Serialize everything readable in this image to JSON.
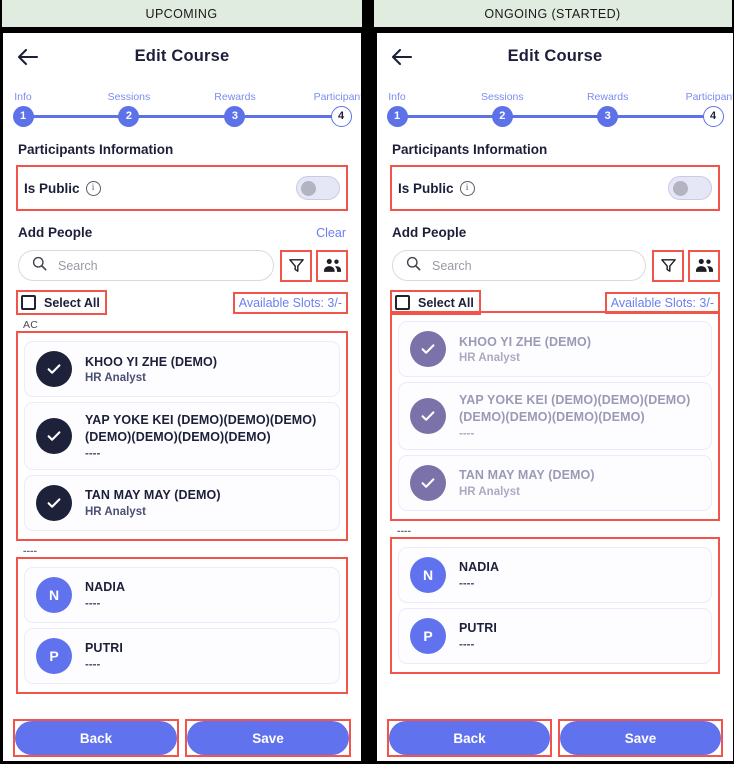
{
  "panels": [
    {
      "id": "upcoming",
      "status_banner": "UPCOMING",
      "appbar": {
        "title": "Edit Course",
        "back_icon": "arrow-left-icon"
      },
      "stepper": {
        "steps": [
          {
            "label": "Info",
            "number": "1",
            "state": "done"
          },
          {
            "label": "Sessions",
            "number": "2",
            "state": "done"
          },
          {
            "label": "Rewards",
            "number": "3",
            "state": "done"
          },
          {
            "label": "Participants",
            "number": "4",
            "state": "current"
          }
        ]
      },
      "participants_information_title": "Participants Information",
      "is_public": {
        "label": "Is Public",
        "info_icon": "info-icon",
        "toggle_state": "off"
      },
      "add_people": {
        "title": "Add People",
        "clear_label": "Clear",
        "show_clear": true
      },
      "search": {
        "placeholder": "Search",
        "value": "",
        "search_icon": "search-icon",
        "filter_icon": "filter-icon",
        "group-icon": "people-group-icon"
      },
      "select_all": {
        "label": "Select All",
        "checked": false
      },
      "available_slots": "Available Slots: 3/-",
      "groups": [
        {
          "label": "AC",
          "dim": false,
          "people": [
            {
              "name": "KHOO YI ZHE (DEMO)",
              "sub": "HR Analyst",
              "avatar_type": "check",
              "avatar_text": ""
            },
            {
              "name": "YAP YOKE KEI (DEMO)(DEMO)(DEMO)(DEMO)(DEMO)(DEMO)(DEMO)",
              "sub": "----",
              "avatar_type": "check",
              "avatar_text": ""
            },
            {
              "name": "TAN MAY MAY (DEMO)",
              "sub": "HR Analyst",
              "avatar_type": "check",
              "avatar_text": ""
            }
          ]
        },
        {
          "label": "----",
          "dim": false,
          "people": [
            {
              "name": "NADIA",
              "sub": "----",
              "avatar_type": "initial",
              "avatar_text": "N"
            },
            {
              "name": "PUTRI",
              "sub": "----",
              "avatar_type": "initial",
              "avatar_text": "P"
            }
          ]
        }
      ],
      "buttons": {
        "back": "Back",
        "save": "Save"
      }
    },
    {
      "id": "ongoing",
      "status_banner": "ONGOING (STARTED)",
      "appbar": {
        "title": "Edit Course",
        "back_icon": "arrow-left-icon"
      },
      "stepper": {
        "steps": [
          {
            "label": "Info",
            "number": "1",
            "state": "done"
          },
          {
            "label": "Sessions",
            "number": "2",
            "state": "done"
          },
          {
            "label": "Rewards",
            "number": "3",
            "state": "done"
          },
          {
            "label": "Participants",
            "number": "4",
            "state": "current"
          }
        ]
      },
      "participants_information_title": "Participants Information",
      "is_public": {
        "label": "Is Public",
        "info_icon": "info-icon",
        "toggle_state": "off"
      },
      "add_people": {
        "title": "Add People",
        "clear_label": "",
        "show_clear": false
      },
      "search": {
        "placeholder": "Search",
        "value": "",
        "search_icon": "search-icon",
        "filter_icon": "filter-icon",
        "group-icon": "people-group-icon"
      },
      "select_all": {
        "label": "Select All",
        "checked": false
      },
      "available_slots": "Available Slots: 3/-",
      "groups": [
        {
          "label": "",
          "dim": true,
          "people": [
            {
              "name": "KHOO YI ZHE (DEMO)",
              "sub": "HR Analyst",
              "avatar_type": "check-dim",
              "avatar_text": ""
            },
            {
              "name": "YAP YOKE KEI (DEMO)(DEMO)(DEMO)(DEMO)(DEMO)(DEMO)(DEMO)",
              "sub": "----",
              "avatar_type": "check-dim",
              "avatar_text": ""
            },
            {
              "name": "TAN MAY MAY (DEMO)",
              "sub": "HR Analyst",
              "avatar_type": "check-dim",
              "avatar_text": ""
            }
          ]
        },
        {
          "label": "----",
          "dim": false,
          "people": [
            {
              "name": "NADIA",
              "sub": "----",
              "avatar_type": "initial",
              "avatar_text": "N"
            },
            {
              "name": "PUTRI",
              "sub": "----",
              "avatar_type": "initial",
              "avatar_text": "P"
            }
          ]
        }
      ],
      "buttons": {
        "back": "Back",
        "save": "Save"
      }
    }
  ],
  "theme": {
    "accent": "#6172ef",
    "accent_light": "#7b8cf0",
    "dark_navy": "#1d1f3a",
    "banner_bg": "#e1ece0",
    "highlight": "#f0544a",
    "avatar_checked": "#1d2139",
    "avatar_checked_dim": "#7a72a8"
  }
}
